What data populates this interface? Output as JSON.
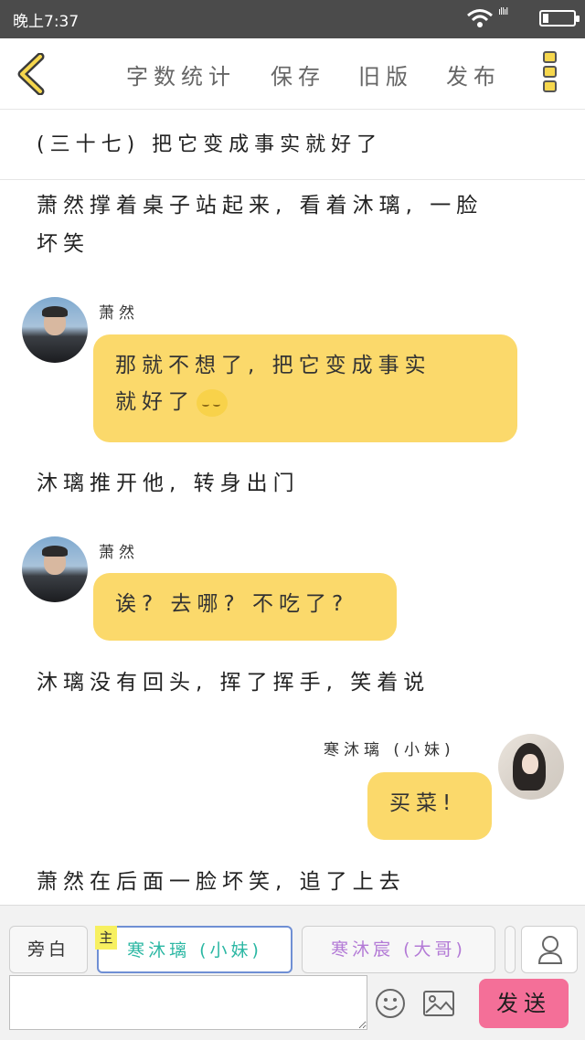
{
  "status_bar": {
    "time": "晚上7:37",
    "signal_text": "ıllıl"
  },
  "toolbar": {
    "word_count": "字数统计",
    "save": "保存",
    "old_version": "旧版",
    "publish": "发布"
  },
  "chapter_title": "(三十七) 把它变成事实就好了",
  "messages": [
    {
      "type": "narration",
      "text_line1": "萧然撑着桌子站起来, 看着沐璃, 一脸",
      "text_line2": "坏笑"
    },
    {
      "type": "chat",
      "speaker": "萧然",
      "text_line1": "那就不想了, 把它变成事实",
      "text_line2": "就好了"
    },
    {
      "type": "narration",
      "text": "沐璃推开他, 转身出门"
    },
    {
      "type": "chat",
      "speaker": "萧然",
      "text": "诶? 去哪? 不吃了?"
    },
    {
      "type": "narration",
      "text": "沐璃没有回头, 挥了挥手, 笑着说"
    },
    {
      "type": "chat",
      "speaker": "寒沐璃 (小妹)",
      "text": "买菜!"
    },
    {
      "type": "narration",
      "text": "萧然在后面一脸坏笑, 追了上去"
    }
  ],
  "bottom_bar": {
    "roles": [
      {
        "label": "旁白",
        "color": "#333333"
      },
      {
        "label": "寒沐璃 (小妹)",
        "color": "#2bb7a3"
      },
      {
        "label": "寒沐宸 (大哥)",
        "color": "#b37ad6"
      }
    ],
    "main_tag": "主",
    "input_value": "",
    "send_label": "发送"
  },
  "colors": {
    "bubble": "#fbd96b",
    "accent_yellow": "#f6d74d",
    "send_button": "#f46f98"
  }
}
